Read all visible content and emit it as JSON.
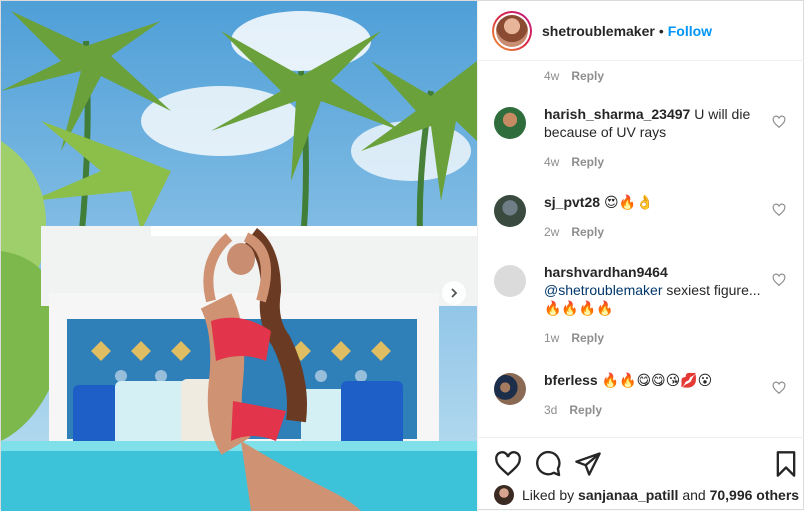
{
  "post": {
    "username": "shetroublemaker",
    "separator": "•",
    "follow_label": "Follow",
    "top_meta": {
      "age": "4w",
      "reply": "Reply"
    },
    "comments": [
      {
        "user": "harish_sharma_23497",
        "text": "U will die because of UV rays",
        "age": "4w",
        "reply": "Reply"
      },
      {
        "user": "sj_pvt28",
        "text": "😍🔥👌",
        "age": "2w",
        "reply": "Reply"
      },
      {
        "user": "harshvardhan9464",
        "mention": "@shetroublemaker",
        "text": "sexiest figure...🔥🔥🔥🔥",
        "age": "1w",
        "reply": "Reply"
      },
      {
        "user": "bferless",
        "text": "🔥🔥😋😋😘💋😮",
        "age": "3d",
        "reply": "Reply"
      }
    ],
    "likes": {
      "prefix": "Liked by",
      "liker": "sanjanaa_patill",
      "joiner": "and",
      "others": "70,996 others"
    }
  },
  "icons": [
    "heart-icon",
    "comment-icon",
    "share-icon",
    "bookmark-icon",
    "next-arrow-icon"
  ],
  "colors": {
    "accent": "#0095f6",
    "muted": "#8e8e8e",
    "text": "#262626",
    "border": "#dbdbdb"
  }
}
